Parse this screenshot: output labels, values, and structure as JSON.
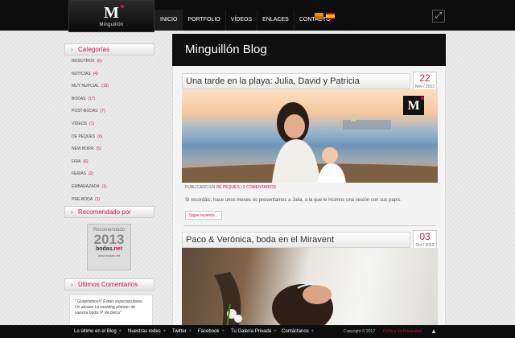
{
  "header": {
    "logo_text": "Minguillón",
    "nav": [
      "INICIO",
      "PORTFOLIO",
      "VÍDEOS",
      "ENLACES",
      "CONTACTO"
    ]
  },
  "sidebar": {
    "categories_title": "Categorías",
    "categories": [
      {
        "label": "NOSOTROS",
        "count": "(6)"
      },
      {
        "label": "NOTICIAS",
        "count": "(4)"
      },
      {
        "label": "MUY NUPCIAL",
        "count": "(19)"
      },
      {
        "label": "BODAS",
        "count": "(17)"
      },
      {
        "label": "POST-BODAS",
        "count": "(7)"
      },
      {
        "label": "VÍDEOS",
        "count": "(1)"
      },
      {
        "label": "DE PEQUES",
        "count": "(6)"
      },
      {
        "label": "NEW BORN",
        "count": "(5)"
      },
      {
        "label": "FIRA",
        "count": "(6)"
      },
      {
        "label": "FERIAS",
        "count": "(2)"
      },
      {
        "label": "EMBARAZADA",
        "count": "(1)"
      },
      {
        "label": "PRE-BODA",
        "count": "(1)"
      }
    ],
    "recommended_title": "Recomendado por",
    "badge": {
      "line1": "Recomendado",
      "year": "2013",
      "brand_a": "bodas.",
      "brand_b": "net",
      "url": "www.bodas.net"
    },
    "comments_title": "Últimos Comentarios",
    "comment": "\" Guapisimos!!! Estais espectaculares. Un abrazo La wedding planner de vuestra boda :P Verónica\""
  },
  "main": {
    "title": "Minguillón Blog",
    "posts": [
      {
        "title": "Una tarde en la playa: Julia, David y Patricia",
        "day": "22",
        "monyear": "Nov / 2013",
        "meta_prefix": "PUBLICADO EN",
        "meta_cat": "DE PEQUES",
        "meta_sep": " | ",
        "meta_comments": "0 COMENTARIOS",
        "excerpt": "Si recordáis, hace unos meses os presentamos a Julia, a la que le hicimos una sesión con sus papis.",
        "more": "Sigue leyendo..."
      },
      {
        "title": "Paco & Verónica, boda en el Miravent",
        "day": "03",
        "monyear": "Oct / 2013"
      }
    ]
  },
  "footer": {
    "links": [
      "Lo último en el Blog",
      "Nuestras redes",
      "Twitter",
      "Facebook",
      "Tu Galería Privada",
      "Contáctanos"
    ],
    "copyright": "Copyright © 2012",
    "privacy": "Política de Privacidad"
  }
}
